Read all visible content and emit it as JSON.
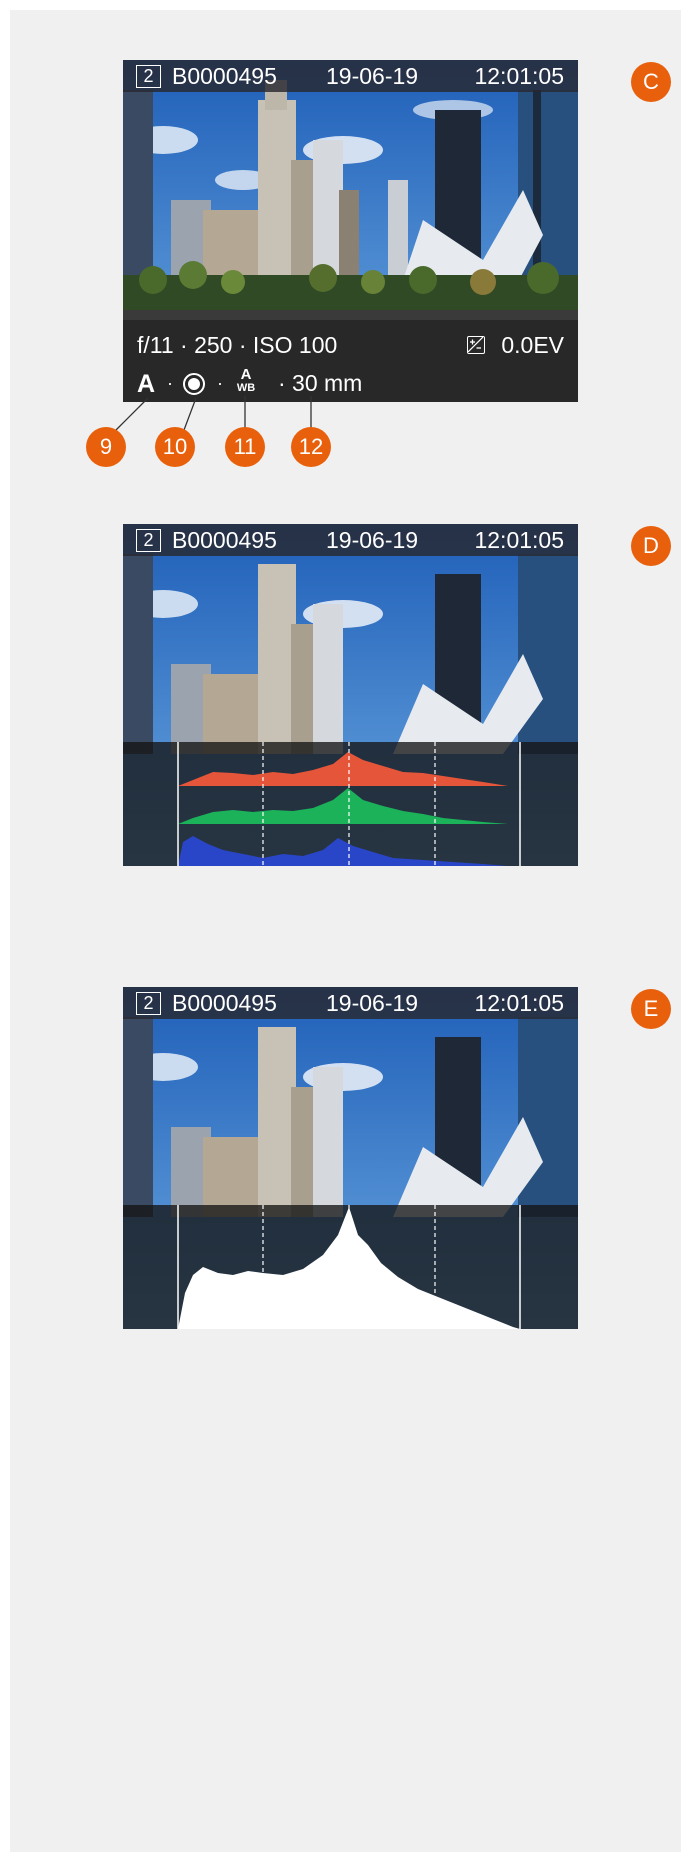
{
  "colors": {
    "accent": "#e8600c",
    "red_channel": "#e4553a",
    "green_channel": "#1bb25a",
    "blue_channel": "#2a46c8"
  },
  "screen_c": {
    "badge": "C",
    "topbar": {
      "slot": "2",
      "file": "B0000495",
      "date": "19-06-19",
      "time": "12:01:05"
    },
    "exposure": "f/11 · 250 · ISO 100",
    "ev_icon": "exposure-compensation-icon",
    "ev_value": "0.0EV",
    "mode": "A",
    "separator": "·",
    "metering_icon": "spot-metering-icon",
    "wb_top": "A",
    "wb_bottom": "WB",
    "focal": "· 30 mm",
    "callouts": [
      "9",
      "10",
      "11",
      "12"
    ]
  },
  "screen_d": {
    "badge": "D",
    "topbar": {
      "slot": "2",
      "file": "B0000495",
      "date": "19-06-19",
      "time": "12:01:05"
    },
    "histogram": "rgb"
  },
  "screen_e": {
    "badge": "E",
    "topbar": {
      "slot": "2",
      "file": "B0000495",
      "date": "19-06-19",
      "time": "12:01:05"
    },
    "histogram": "luminance"
  }
}
